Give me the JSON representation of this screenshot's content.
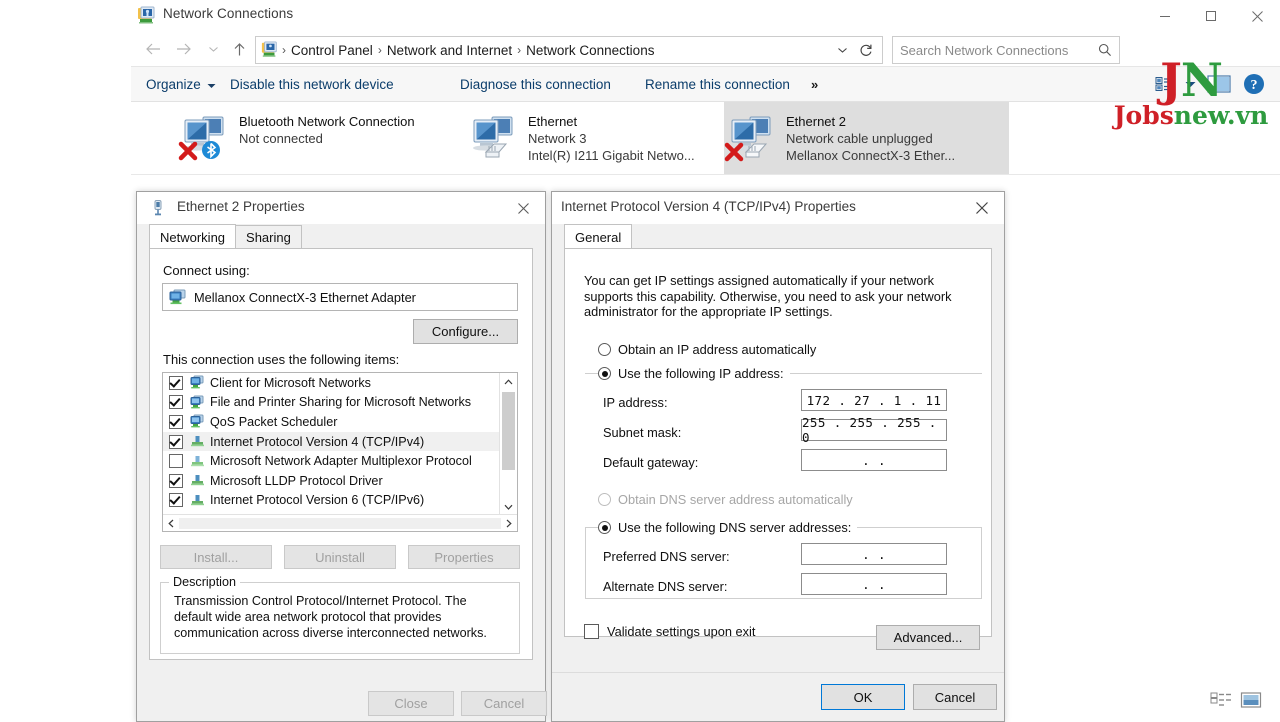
{
  "window": {
    "title": "Network Connections",
    "icon": "network-connections-icon",
    "buttons": {
      "minimize": "—",
      "maximize": "☐",
      "close": "✕"
    }
  },
  "addressbar": {
    "crumbs": [
      "Control Panel",
      "Network and Internet",
      "Network Connections"
    ],
    "separator": "›",
    "dropdown_icon": "chevron-down-icon",
    "refresh_icon": "refresh-icon"
  },
  "search": {
    "placeholder": "Search Network Connections",
    "value": "",
    "icon": "search-icon"
  },
  "commandbar": {
    "organize": "Organize",
    "items": [
      "Disable this network device",
      "Diagnose this connection",
      "Rename this connection"
    ],
    "overflow": "»",
    "view_icon": "view-options-icon",
    "preview_icon": "preview-pane-icon",
    "help_icon": "help-icon"
  },
  "adapters": [
    {
      "name": "Bluetooth Network Connection",
      "status": "Not connected",
      "device": "",
      "selected": false,
      "icon": "bluetooth-adapter-icon",
      "error": true
    },
    {
      "name": "Ethernet",
      "status": "Network 3",
      "device": "Intel(R) I211 Gigabit Netwo...",
      "selected": false,
      "icon": "ethernet-adapter-icon",
      "error": false
    },
    {
      "name": "Ethernet 2",
      "status": "Network cable unplugged",
      "device": "Mellanox ConnectX-3 Ether...",
      "selected": true,
      "icon": "ethernet-adapter-icon",
      "error": true
    }
  ],
  "status_bar": {
    "details_view_icon": "details-view-icon",
    "large_icons_view_icon": "large-icons-view-icon"
  },
  "watermark": {
    "logo_j": "J",
    "logo_n": "N",
    "text_red": "Jobs",
    "text_green": "new.vn"
  },
  "eth_dialog": {
    "title": "Ethernet 2 Properties",
    "icon": "network-adapter-icon",
    "close_icon": "close-icon",
    "tabs": [
      {
        "label": "Networking",
        "active": true
      },
      {
        "label": "Sharing",
        "active": false
      }
    ],
    "connect_using_label": "Connect using:",
    "adapter_name": "Mellanox ConnectX-3 Ethernet Adapter",
    "adapter_icon": "nic-icon",
    "configure_button": "Configure...",
    "items_label": "This connection uses the following items:",
    "items": [
      {
        "label": "Client for Microsoft Networks",
        "checked": true,
        "selected": false,
        "icon": "client-icon"
      },
      {
        "label": "File and Printer Sharing for Microsoft Networks",
        "checked": true,
        "selected": false,
        "icon": "service-icon"
      },
      {
        "label": "QoS Packet Scheduler",
        "checked": true,
        "selected": false,
        "icon": "service-icon"
      },
      {
        "label": "Internet Protocol Version 4 (TCP/IPv4)",
        "checked": true,
        "selected": true,
        "icon": "protocol-icon"
      },
      {
        "label": "Microsoft Network Adapter Multiplexor Protocol",
        "checked": false,
        "selected": false,
        "icon": "protocol-icon"
      },
      {
        "label": "Microsoft LLDP Protocol Driver",
        "checked": true,
        "selected": false,
        "icon": "protocol-icon"
      },
      {
        "label": "Internet Protocol Version 6 (TCP/IPv6)",
        "checked": true,
        "selected": false,
        "icon": "protocol-icon"
      }
    ],
    "install_button": "Install...",
    "uninstall_button": "Uninstall",
    "properties_button": "Properties",
    "description_legend": "Description",
    "description_text": "Transmission Control Protocol/Internet Protocol. The default wide area network protocol that provides communication across diverse interconnected networks.",
    "close_button": "Close",
    "cancel_button": "Cancel"
  },
  "tcp_dialog": {
    "title": "Internet Protocol Version 4 (TCP/IPv4) Properties",
    "close_icon": "close-icon",
    "tabs": [
      {
        "label": "General",
        "active": true
      }
    ],
    "intro": "You can get IP settings assigned automatically if your network supports this capability. Otherwise, you need to ask your network administrator for the appropriate IP settings.",
    "ip_auto_label": "Obtain an IP address automatically",
    "ip_manual_label": "Use the following IP address:",
    "ip_mode": "manual",
    "fields": [
      {
        "label": "IP address:",
        "value": "172 . 27 .  1  . 11",
        "name": "ip-address-field"
      },
      {
        "label": "Subnet mask:",
        "value": "255 . 255 . 255 .  0",
        "name": "subnet-mask-field"
      },
      {
        "label": "Default gateway:",
        "value": " .    .   ",
        "name": "default-gateway-field"
      }
    ],
    "dns_auto_label": "Obtain DNS server address automatically",
    "dns_manual_label": "Use the following DNS server addresses:",
    "dns_mode": "manual",
    "dns_fields": [
      {
        "label": "Preferred DNS server:",
        "value": " .    .   ",
        "name": "preferred-dns-field"
      },
      {
        "label": "Alternate DNS server:",
        "value": " .    .   ",
        "name": "alternate-dns-field"
      }
    ],
    "validate_label": "Validate settings upon exit",
    "validate_checked": false,
    "advanced_button": "Advanced...",
    "ok_button": "OK",
    "cancel_button": "Cancel"
  },
  "colors": {
    "accent": "#0078d7",
    "command_link": "#0b3d6b",
    "selection": "#dedede",
    "watermark_red": "#cf2027",
    "watermark_green": "#2e9b3f"
  }
}
